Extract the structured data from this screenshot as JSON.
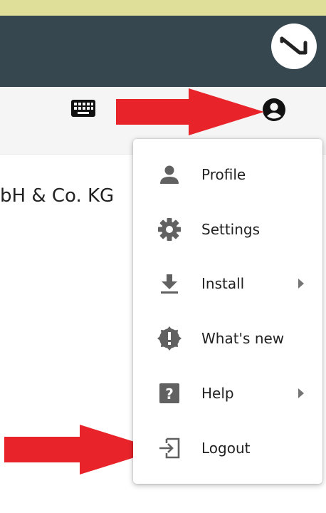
{
  "content": {
    "company_fragment": "bH & Co. KG"
  },
  "menu": {
    "items": [
      {
        "label": "Profile",
        "icon": "person-icon",
        "submenu": false
      },
      {
        "label": "Settings",
        "icon": "gear-icon",
        "submenu": false
      },
      {
        "label": "Install",
        "icon": "download-icon",
        "submenu": true
      },
      {
        "label": "What's new",
        "icon": "new-badge-icon",
        "submenu": false
      },
      {
        "label": "Help",
        "icon": "help-icon",
        "submenu": true
      },
      {
        "label": "Logout",
        "icon": "logout-icon",
        "submenu": false
      }
    ]
  },
  "colors": {
    "top_strip": "#dfdf9a",
    "header": "#37474f",
    "toolbar": "#f5f5f5",
    "icon_gray": "#616161",
    "annotation_arrow": "#e8242a"
  }
}
